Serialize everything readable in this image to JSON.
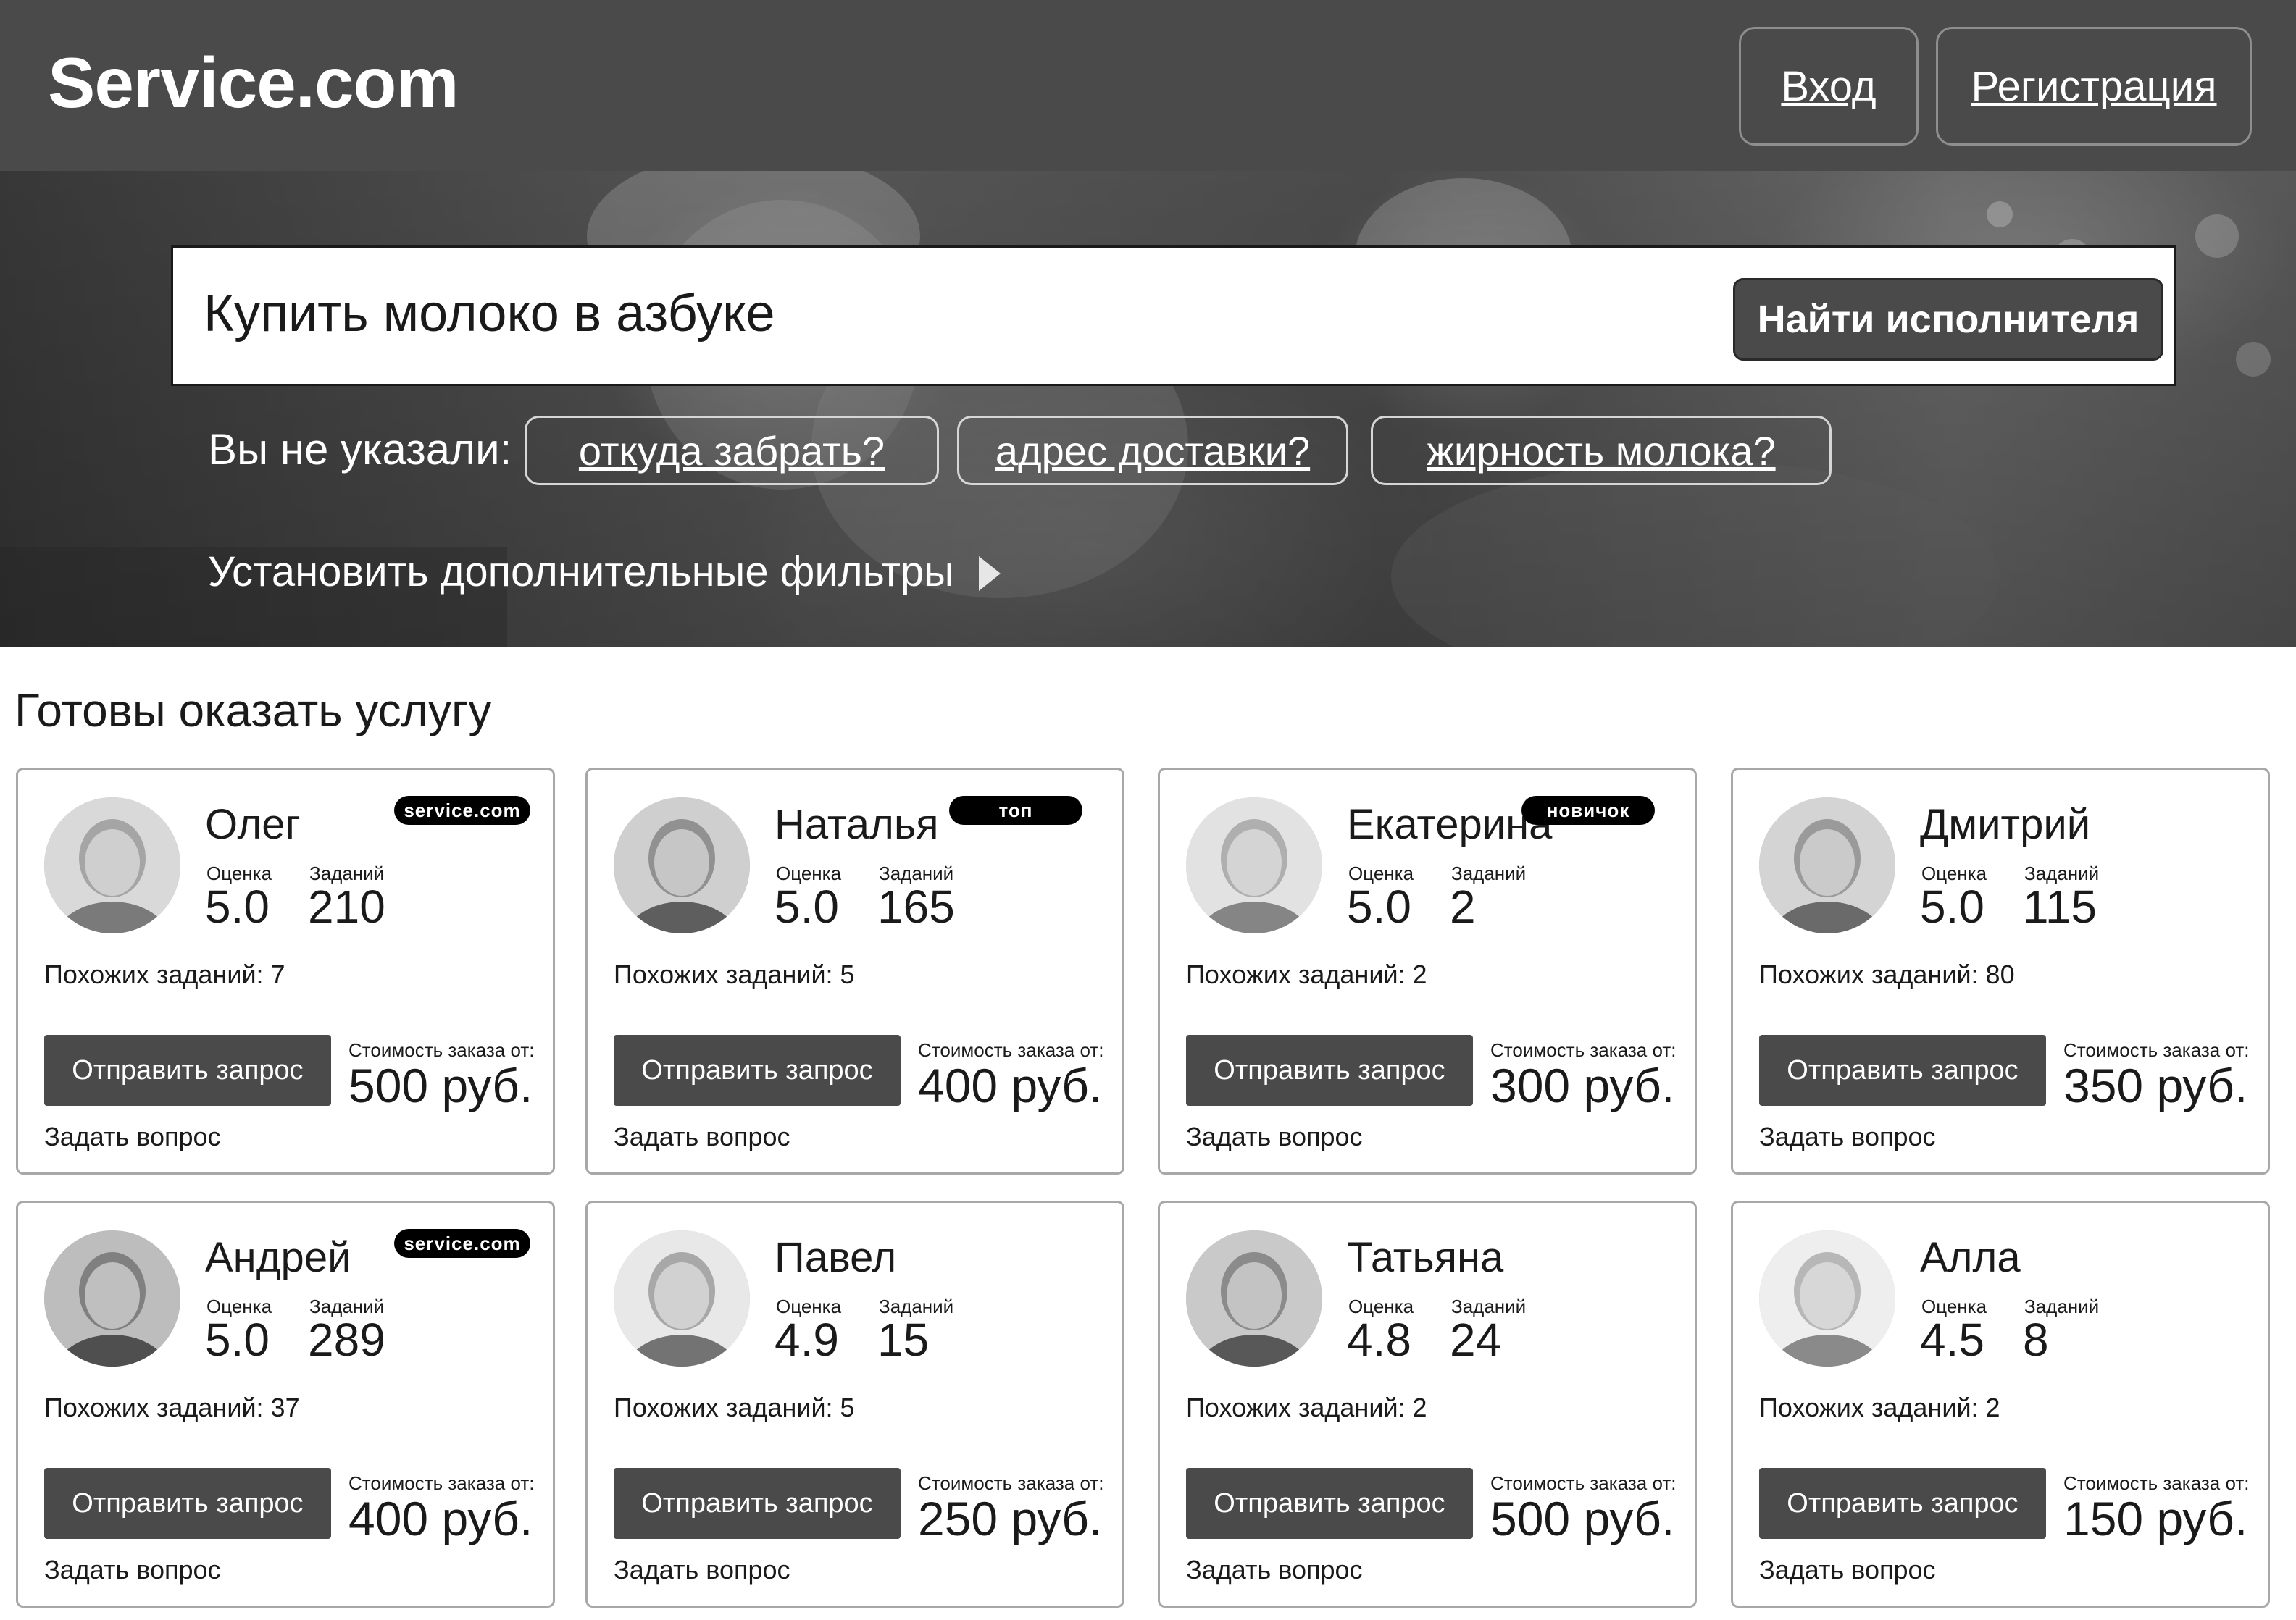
{
  "header": {
    "logo": "Service.com",
    "login": "Вход",
    "register": "Регистрация"
  },
  "search": {
    "query": "Купить молоко в азбуке",
    "button": "Найти исполнителя"
  },
  "clarify": {
    "label": "Вы не указали:",
    "chips": [
      "откуда забрать?",
      "адрес доставки?",
      "жирность молока?"
    ]
  },
  "filters_link": "Установить дополнительные фильтры",
  "section_title": "Готовы оказать услугу",
  "common": {
    "rating_label": "Оценка",
    "tasks_label": "Заданий",
    "send_label": "Отправить запрос",
    "cost_label": "Стоимость заказа от:",
    "ask_label": "Задать вопрос"
  },
  "performers": [
    {
      "name": "Олег",
      "badge": "service.com",
      "rating": "5.0",
      "tasks": "210",
      "similar": "Похожих заданий: 7",
      "price": "500 руб."
    },
    {
      "name": "Наталья",
      "badge": "топ",
      "rating": "5.0",
      "tasks": "165",
      "similar": "Похожих заданий: 5",
      "price": "400 руб."
    },
    {
      "name": "Екатерина",
      "badge": "новичок",
      "rating": "5.0",
      "tasks": "2",
      "similar": "Похожих заданий: 2",
      "price": "300 руб."
    },
    {
      "name": "Дмитрий",
      "badge": "",
      "rating": "5.0",
      "tasks": "115",
      "similar": "Похожих заданий: 80",
      "price": "350 руб."
    },
    {
      "name": "Андрей",
      "badge": "service.com",
      "rating": "5.0",
      "tasks": "289",
      "similar": "Похожих заданий: 37",
      "price": "400 руб."
    },
    {
      "name": "Павел",
      "badge": "",
      "rating": "4.9",
      "tasks": "15",
      "similar": "Похожих заданий: 5",
      "price": "250 руб."
    },
    {
      "name": "Татьяна",
      "badge": "",
      "rating": "4.8",
      "tasks": "24",
      "similar": "Похожих заданий: 2",
      "price": "500 руб."
    },
    {
      "name": "Алла",
      "badge": "",
      "rating": "4.5",
      "tasks": "8",
      "similar": "Похожих заданий: 2",
      "price": "150 руб."
    }
  ]
}
